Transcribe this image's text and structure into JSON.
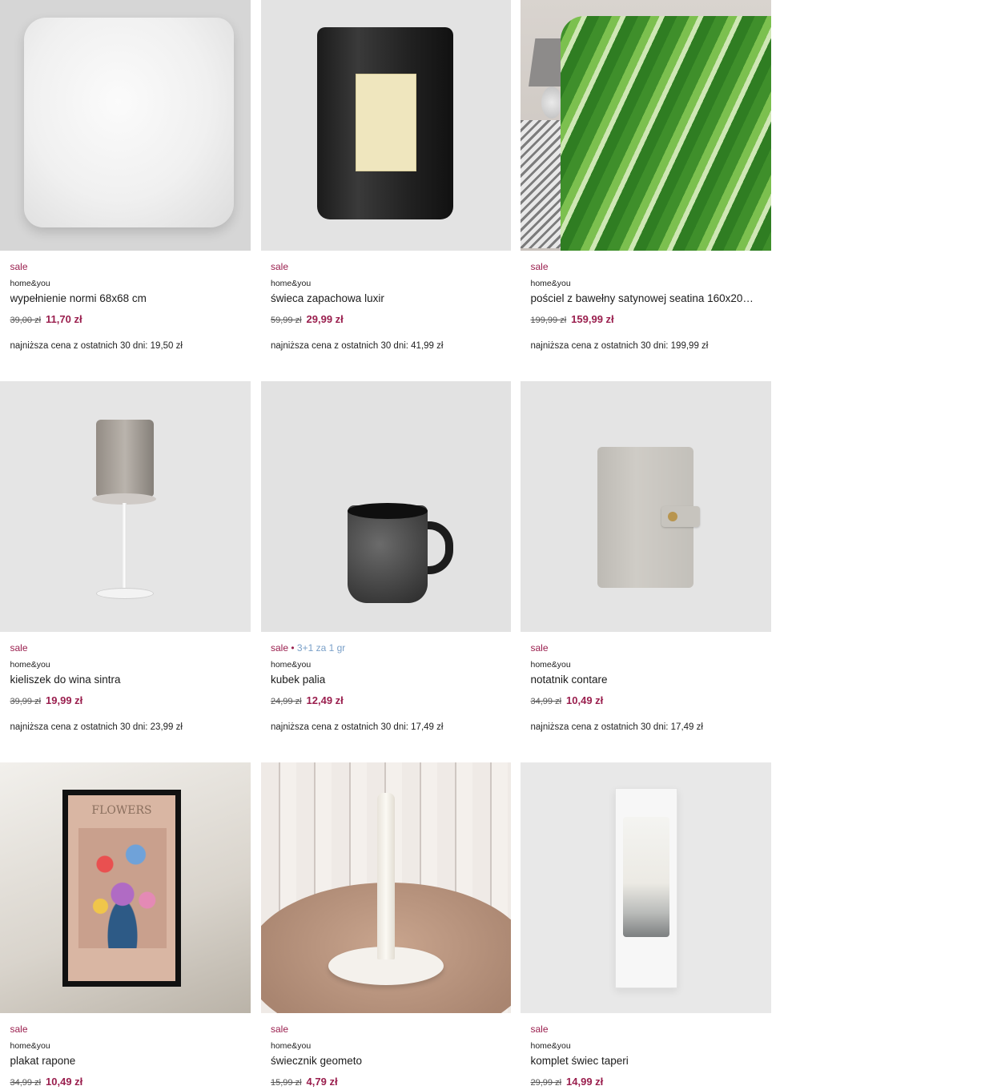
{
  "products": [
    {
      "tag": "sale",
      "promo": "",
      "brand": "home&you",
      "name": "wypełnienie normi 68x68 cm",
      "old_price": "39,00 zł",
      "new_price": "11,70 zł",
      "lowest": "najniższa cena z ostatnich 30 dni: 19,50 zł",
      "image": "pillow"
    },
    {
      "tag": "sale",
      "promo": "",
      "brand": "home&you",
      "name": "świeca zapachowa luxir",
      "old_price": "59,99 zł",
      "new_price": "29,99 zł",
      "lowest": "najniższa cena z ostatnich 30 dni: 41,99 zł",
      "image": "candle-jar"
    },
    {
      "tag": "sale",
      "promo": "",
      "brand": "home&you",
      "name": "pościel z bawełny satynowej seatina 160x20…",
      "old_price": "199,99 zł",
      "new_price": "159,99 zł",
      "lowest": "najniższa cena z ostatnich 30 dni: 199,99 zł",
      "image": "bedding"
    },
    {
      "tag": "sale",
      "promo": "",
      "brand": "home&you",
      "name": "kieliszek do wina sintra",
      "old_price": "39,99 zł",
      "new_price": "19,99 zł",
      "lowest": "najniższa cena z ostatnich 30 dni: 23,99 zł",
      "image": "wine-glass"
    },
    {
      "tag": "sale",
      "promo": "3+1 za 1 gr",
      "brand": "home&you",
      "name": "kubek palia",
      "old_price": "24,99 zł",
      "new_price": "12,49 zł",
      "lowest": "najniższa cena z ostatnich 30 dni: 17,49 zł",
      "image": "mug"
    },
    {
      "tag": "sale",
      "promo": "",
      "brand": "home&you",
      "name": "notatnik contare",
      "old_price": "34,99 zł",
      "new_price": "10,49 zł",
      "lowest": "najniższa cena z ostatnich 30 dni: 17,49 zł",
      "image": "notebook"
    },
    {
      "tag": "sale",
      "promo": "",
      "brand": "home&you",
      "name": "plakat rapone",
      "old_price": "34,99 zł",
      "new_price": "10,49 zł",
      "lowest": "",
      "image": "poster",
      "poster_title": "FLOWERS"
    },
    {
      "tag": "sale",
      "promo": "",
      "brand": "home&you",
      "name": "świecznik geometo",
      "old_price": "15,99 zł",
      "new_price": "4,79 zł",
      "lowest": "",
      "image": "candle-holder"
    },
    {
      "tag": "sale",
      "promo": "",
      "brand": "home&you",
      "name": "komplet świec taperi",
      "old_price": "29,99 zł",
      "new_price": "14,99 zł",
      "lowest": "",
      "image": "candle-set"
    }
  ],
  "colors": {
    "sale": "#9a1f4e",
    "promo": "#7aa0c8",
    "text": "#1c1c1c",
    "thumb_bg": "#e4e4e4"
  }
}
